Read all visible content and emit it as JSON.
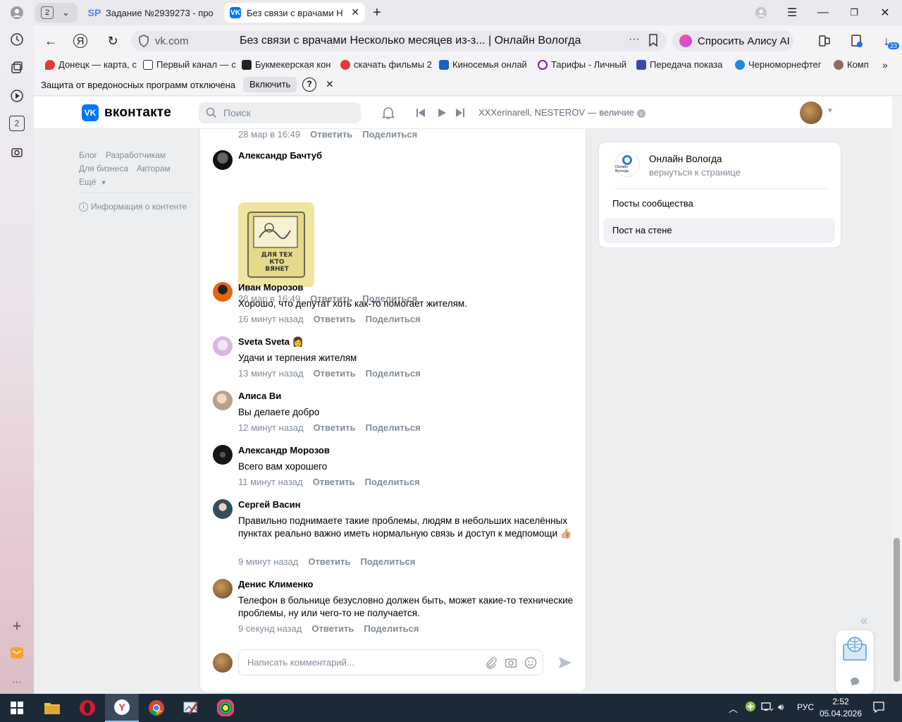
{
  "browser": {
    "tabs": [
      {
        "label": "Задание №2939273 - про",
        "favicon": "SP"
      },
      {
        "label": "Без связи с врачами Н",
        "favicon": "VK"
      }
    ],
    "tab_group_count": "2",
    "url_host": "vk.com",
    "page_title": "Без связи с врачами Несколько месяцев из-з... | Онлайн Вологда",
    "alice_button": "Спросить Алису AI",
    "downloads_badge": "23",
    "rail_badge": "2",
    "bookmarks": [
      "Донецк — карта, с",
      "Первый канал — с",
      "Букмекерская кон",
      "скачать фильмы 2",
      "Киносемья онлай",
      "Тарифы - Личный",
      "Передача показа",
      "Черноморнефтег",
      "Комп"
    ],
    "infobar": {
      "message": "Защита от вредоносных программ отключена",
      "enable_button": "Включить",
      "help": "?"
    }
  },
  "vk": {
    "logo_text": "вконтакте",
    "logo_mark": "VK",
    "search_placeholder": "Поиск",
    "now_playing": "XXXerinarell, NESTEROV — величие",
    "left_links": {
      "row1": [
        "Блог",
        "Разработчикам"
      ],
      "row2": [
        "Для бизнеса",
        "Авторам"
      ],
      "more": "Ещё",
      "content_info": "Информация о контенте"
    },
    "top_meta": {
      "time": "28 мар в 16:49",
      "reply": "Ответить",
      "share": "Поделиться"
    },
    "sticker_text": "ДЛЯ ТЕХ КТО ВЯНЕТ",
    "comments": [
      {
        "name": "Александр Бачтуб",
        "text": "",
        "time": "28 мар в 16:49",
        "reply": "Ответить",
        "share": "Поделиться"
      },
      {
        "name": "Иван Морозов",
        "text": "Хорошо, что депутат хоть как-то помогает жителям.",
        "time": "16 минут назад",
        "reply": "Ответить",
        "share": "Поделиться"
      },
      {
        "name": "Sveta Sveta",
        "text": "Удачи и терпения жителям",
        "time": "13 минут назад",
        "reply": "Ответить",
        "share": "Поделиться"
      },
      {
        "name": "Алиса Ви",
        "text": "Вы делаете добро",
        "time": "12 минут назад",
        "reply": "Ответить",
        "share": "Поделиться"
      },
      {
        "name": "Александр Морозов",
        "text": "Всего вам хорошего",
        "time": "11 минут назад",
        "reply": "Ответить",
        "share": "Поделиться"
      },
      {
        "name": "Сергей Васин",
        "text": "Правильно поднимаете такие проблемы, людям в небольших населённых пунктах реально важно иметь нормальную связь и доступ к медпомощи 👍🏼",
        "time": "9 минут назад",
        "reply": "Ответить",
        "share": "Поделиться"
      },
      {
        "name": "Денис Клименко",
        "text": "Телефон в больнице безусловно должен быть, может какие-то технические проблемы, ну или чего-то не получается.",
        "time": "9 секунд назад",
        "reply": "Ответить",
        "share": "Поделиться"
      }
    ],
    "composer_placeholder": "Написать комментарий...",
    "community": {
      "name": "Онлайн Вологда",
      "back_link": "вернуться к странице",
      "logo_text": "Онлайн Вологда",
      "menu": [
        "Посты сообщества",
        "Пост на стене"
      ],
      "selected": "Пост на стене"
    }
  },
  "taskbar": {
    "lang": "РУС",
    "time": "2:52",
    "date": "05.04.2026"
  },
  "colors": {
    "vk_blue": "#0077ff",
    "meta_gray": "#818c99",
    "taskbar": "#1c2a38"
  }
}
